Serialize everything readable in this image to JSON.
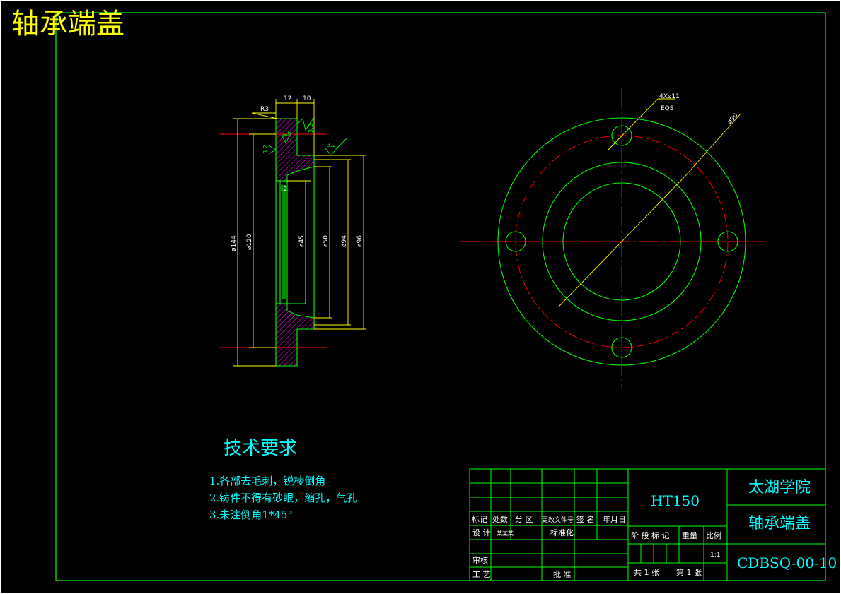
{
  "title": "轴承端盖",
  "requirements": {
    "heading": "技术要求",
    "items": [
      "1.各部去毛刺，锐棱倒角",
      "2.铸件不得有砂眼，缩孔，气孔",
      "3.未注倒角1*45°"
    ]
  },
  "section_view": {
    "dimensions": {
      "r3": "R3",
      "w12": "12",
      "w10": "10",
      "d144": "ø144",
      "d120": "ø120",
      "d45": "ø45",
      "d50": "ø50",
      "d94": "ø94",
      "d96": "ø96",
      "small": "2"
    },
    "roughness": {
      "top_right": "3.2",
      "top_mid": "1.6",
      "left": "3.2",
      "right": "3.2"
    }
  },
  "front_view": {
    "holes_label_1": "4Xø11",
    "holes_label_2": "EQS",
    "pcd_label": "ø90"
  },
  "title_block": {
    "material": "HT150",
    "school": "太湖学院",
    "part_name": "轴承端盖",
    "drawing_no": "CDBSQ-00-10",
    "headers": [
      "标记",
      "处数",
      "分 区",
      "更改文件号",
      "签 名",
      "年月日"
    ],
    "design": "设 计",
    "standardize": "标准化",
    "check": "审核",
    "process": "工 艺",
    "approve": "批 准",
    "stage_mark": "阶 段 标 记",
    "weight": "重量",
    "ratio": "比例",
    "scale": "1:1",
    "total_sheets": "共 1 张",
    "sheet_no": "第 1 张",
    "designer": "某某某"
  },
  "colors": {
    "outline": "#00ff00",
    "center": "#ff0000",
    "dimension": "#ffff00",
    "hatch": "#ff00ff",
    "text": "#00ffff",
    "white": "#ffffff"
  }
}
